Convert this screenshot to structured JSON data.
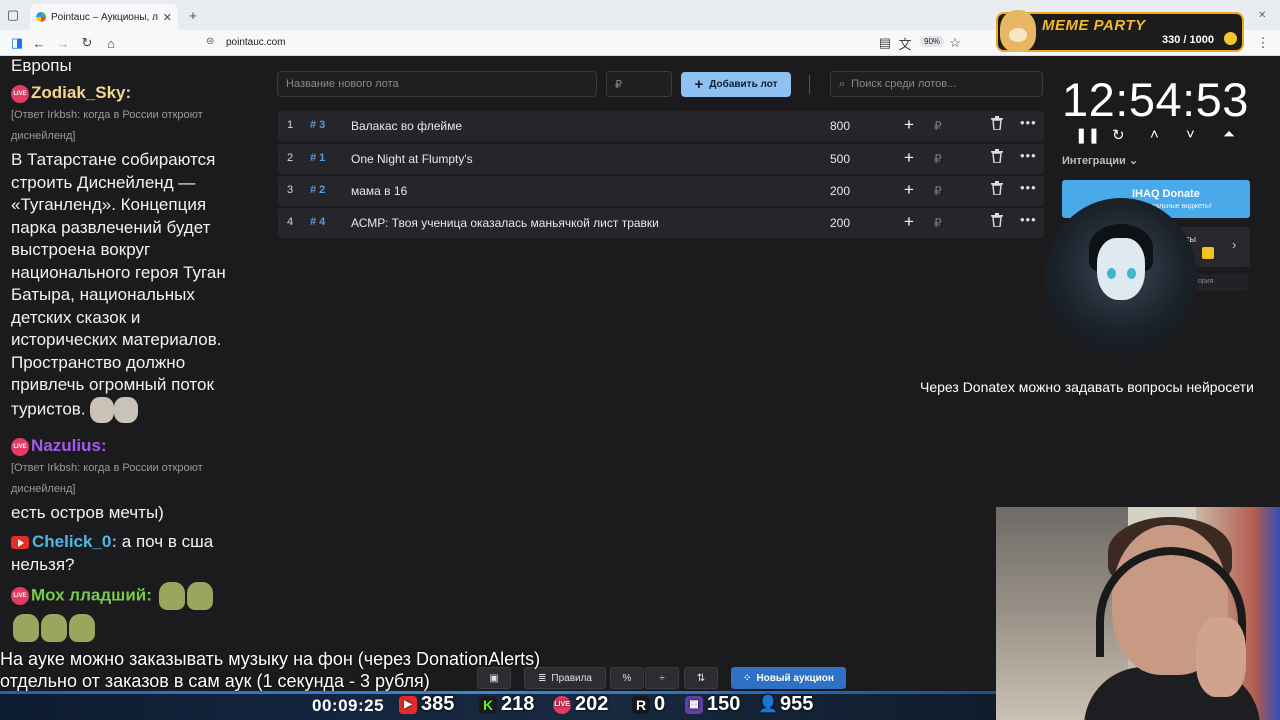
{
  "browser": {
    "tab_title": "Pointauc – Аукционы, лотереи",
    "url": "pointauc.com",
    "zoom": "90%"
  },
  "meme_party": {
    "title": "MEME PARTY",
    "score": "330 / 1000"
  },
  "auction": {
    "new_lot_placeholder": "Название нового лота",
    "amount_placeholder": "₽",
    "add_lot_label": "Добавить лот",
    "search_placeholder": "Поиск среди лотов...",
    "lots": [
      {
        "num": "1",
        "id": "# 3",
        "name": "Валакас во флейме",
        "amount": "800",
        "currency": "₽"
      },
      {
        "num": "2",
        "id": "# 1",
        "name": "One Night at Flumpty's",
        "amount": "500",
        "currency": "₽"
      },
      {
        "num": "3",
        "id": "# 2",
        "name": "мама в 16",
        "amount": "200",
        "currency": "₽"
      },
      {
        "num": "4",
        "id": "# 4",
        "name": "АСМР: Твоя ученица оказалась маньячкой лист травки",
        "amount": "200",
        "currency": "₽"
      }
    ]
  },
  "right_panel": {
    "timer": "12:54:53",
    "integrations_label": "Интеграции",
    "ihaq_title": "IHAQ Donate",
    "ihaq_sub": "кальные виджеты!",
    "services_label": "исы",
    "history_label": "ория",
    "donatex_message": "Через Donatex можно задавать вопросы нейросети"
  },
  "chat": {
    "line_europe": "Европы",
    "msg1_user": "Zodiak_Sky:",
    "msg1_reply": "[Ответ Irkbsh: когда в России откроют диснейленд]",
    "msg1_text": "В Татарстане собираются строить Диснейленд — «Туганленд». Концепция парка развлечений будет выстроена вокруг национального героя Туган Батыра, национальных детских сказок и исторических материалов. Пространство должно привлечь огромный поток туристов.",
    "msg2_user": "Nazulius:",
    "msg2_reply": "[Ответ Irkbsh: когда в России откроют диснейленд]",
    "msg2_text": "есть остров мечты)",
    "msg3_user": "Chelick_0:",
    "msg3_text": "а поч в сша нельзя?",
    "msg4_user": "Мох лладший:",
    "live_badge": "LIVE"
  },
  "ticker": {
    "line1": "На ауке можно заказывать музыку на фон (через DonationAlerts)",
    "line2": "отдельно от заказов в сам аук (1 секунда - 3 рубля)"
  },
  "toolbar": {
    "rules_label": "Правила",
    "percent_label": "%",
    "new_auction_label": "Новый аукцион"
  },
  "stream_stats": {
    "uptime": "00:09:25",
    "youtube": "385",
    "kick": "218",
    "vk": "202",
    "rutube": "0",
    "twitch": "150",
    "total": "955"
  },
  "colors": {
    "accent_blue": "#8fc1f2",
    "lot_id_blue": "#5b9bd8",
    "ihaq_blue": "#4aa9e9",
    "new_auction_blue": "#2e71c7"
  }
}
